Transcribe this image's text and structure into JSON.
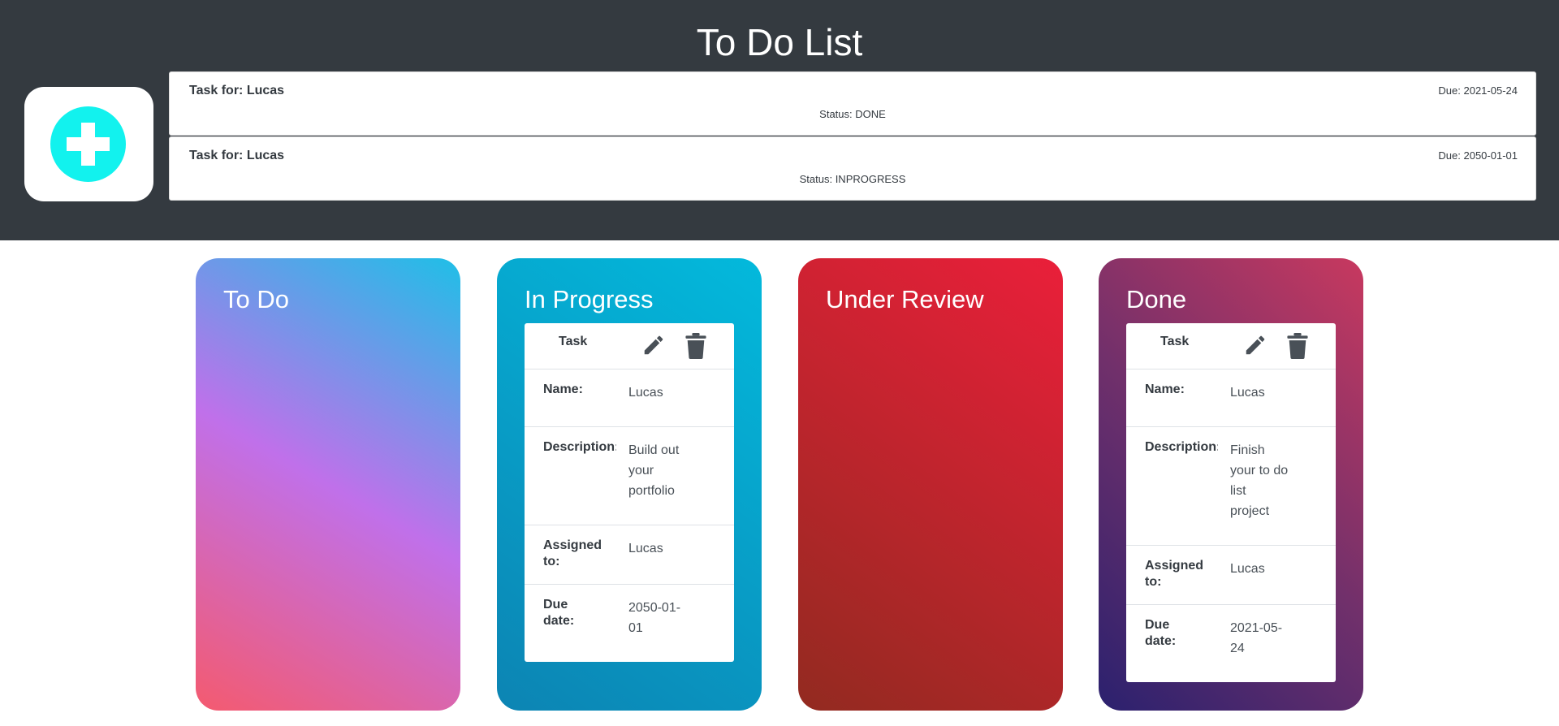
{
  "header": {
    "title": "To Do List",
    "add_icon": "plus-circle-icon",
    "summary": [
      {
        "who": "Task for: Lucas",
        "due": "Due: 2021-05-24",
        "status": "Status: DONE"
      },
      {
        "who": "Task for: Lucas",
        "due": "Due: 2050-01-01",
        "status": "Status: INPROGRESS"
      }
    ]
  },
  "colors": {
    "header_bg": "#343a40",
    "add_accent": "#12f2ee",
    "todo": [
      "#f45a6f",
      "#c070ea",
      "#1fbfe7"
    ],
    "in_progress": [
      "#03b9dc",
      "#0c84b3"
    ],
    "under_review": [
      "#ea1f3a",
      "#922a20"
    ],
    "done": [
      "#2b216e",
      "#71306b",
      "#c8395f"
    ]
  },
  "columns": [
    {
      "title": "To Do"
    },
    {
      "title": "In Progress",
      "card": {
        "label": "Task",
        "edit_icon": "pencil-icon",
        "delete_icon": "trash-icon",
        "name_label": "Name:",
        "name": "Lucas",
        "description_label": "Description:",
        "description": "Build out your portfolio",
        "assigned_label": "Assigned to:",
        "assigned": "Lucas",
        "due_label": "Due date:",
        "due": "2050-01-01"
      }
    },
    {
      "title": "Under Review"
    },
    {
      "title": "Done",
      "card": {
        "label": "Task",
        "edit_icon": "pencil-icon",
        "delete_icon": "trash-icon",
        "name_label": "Name:",
        "name": "Lucas",
        "description_label": "Description:",
        "description": "Finish your to do list project",
        "assigned_label": "Assigned to:",
        "assigned": "Lucas",
        "due_label": "Due date:",
        "due": "2021-05-24"
      }
    }
  ]
}
